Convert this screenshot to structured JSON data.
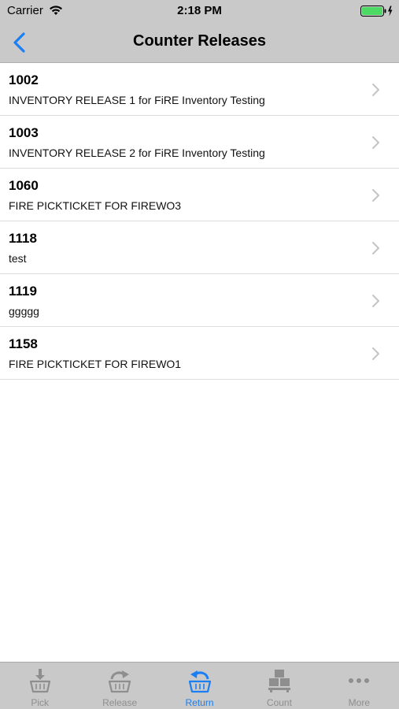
{
  "status_bar": {
    "carrier": "Carrier",
    "time": "2:18 PM",
    "battery_color": "#4cd964"
  },
  "nav": {
    "title": "Counter Releases",
    "accent_color": "#1a7ef5",
    "back_icon": "chevron-left-icon"
  },
  "releases": [
    {
      "id": "1002",
      "description": "INVENTORY RELEASE 1 for FiRE Inventory Testing"
    },
    {
      "id": "1003",
      "description": "INVENTORY RELEASE 2 for FiRE Inventory Testing"
    },
    {
      "id": "1060",
      "description": "FIRE PICKTICKET FOR FIREWO3"
    },
    {
      "id": "1118",
      "description": "test"
    },
    {
      "id": "1119",
      "description": "ggggg"
    },
    {
      "id": "1158",
      "description": "FIRE PICKTICKET FOR FIREWO1"
    }
  ],
  "tabs": [
    {
      "label": "Pick",
      "icon": "basket-download-icon",
      "active": false
    },
    {
      "label": "Release",
      "icon": "basket-forward-icon",
      "active": false
    },
    {
      "label": "Return",
      "icon": "basket-return-icon",
      "active": true
    },
    {
      "label": "Count",
      "icon": "boxes-icon",
      "active": false
    },
    {
      "label": "More",
      "icon": "more-dots-icon",
      "active": false
    }
  ]
}
